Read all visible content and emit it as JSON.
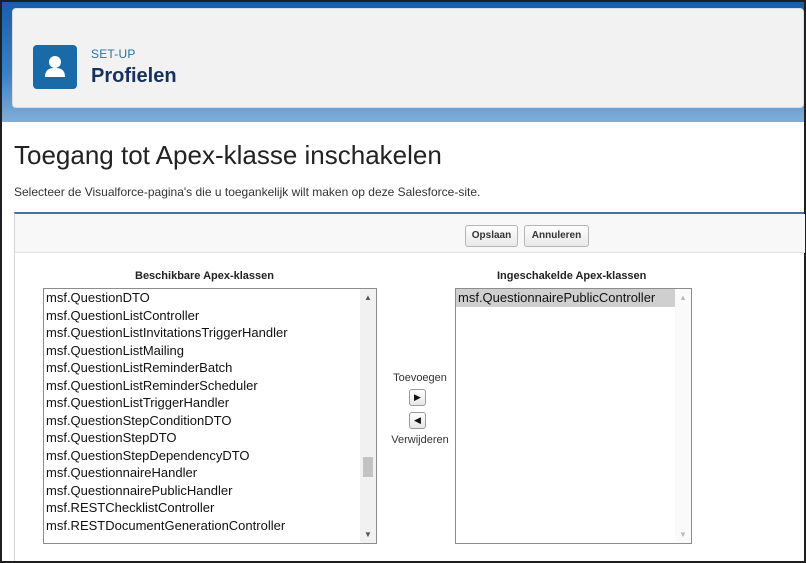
{
  "header": {
    "eyebrow": "SET-UP",
    "title": "Profielen"
  },
  "page": {
    "title": "Toegang tot Apex-klasse inschakelen",
    "description": "Selecteer de Visualforce-pagina's die u toegankelijk wilt maken op deze Salesforce-site."
  },
  "buttons": {
    "save": "Opslaan",
    "cancel": "Annuleren"
  },
  "available": {
    "label": "Beschikbare Apex-klassen",
    "items": [
      "msf.QuestionDTO",
      "msf.QuestionListController",
      "msf.QuestionListInvitationsTriggerHandler",
      "msf.QuestionListMailing",
      "msf.QuestionListReminderBatch",
      "msf.QuestionListReminderScheduler",
      "msf.QuestionListTriggerHandler",
      "msf.QuestionStepConditionDTO",
      "msf.QuestionStepDTO",
      "msf.QuestionStepDependencyDTO",
      "msf.QuestionnaireHandler",
      "msf.QuestionnairePublicHandler",
      "msf.RESTChecklistController",
      "msf.RESTDocumentGenerationController"
    ]
  },
  "controls": {
    "add": "Toevoegen",
    "remove": "Verwijderen",
    "add_icon": "triangle-right-icon",
    "remove_icon": "triangle-left-icon"
  },
  "enabled": {
    "label": "Ingeschakelde Apex-klassen",
    "items": [
      "msf.QuestionnairePublicController"
    ]
  },
  "colors": {
    "brand_blue": "#1b6aa8",
    "header_text": "#16325c"
  }
}
